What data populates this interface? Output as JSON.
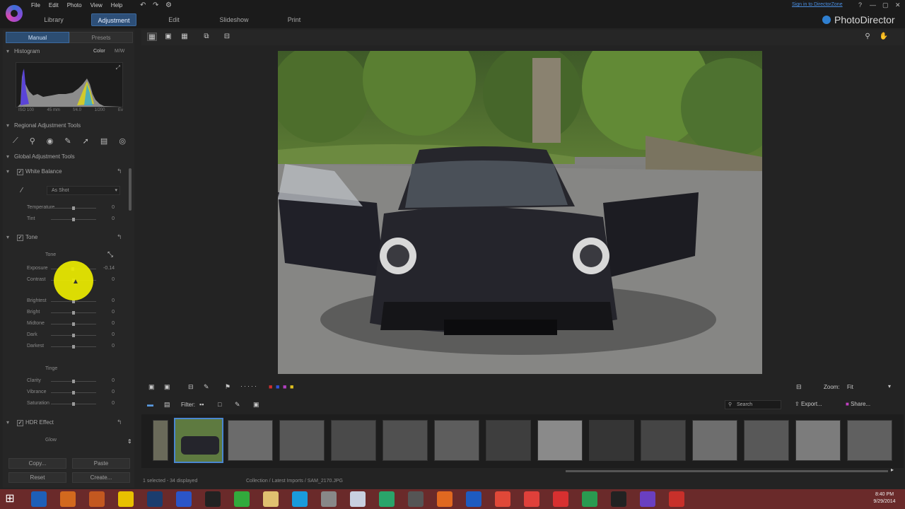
{
  "menu": [
    "File",
    "Edit",
    "Photo",
    "View",
    "Help"
  ],
  "maintabs": [
    "Library",
    "Adjustment",
    "Edit",
    "Slideshow",
    "Print"
  ],
  "active_maintab": "Adjustment",
  "signin": "Sign in to DirectorZone",
  "window_controls": [
    "?",
    "—",
    "▢",
    "✕"
  ],
  "brand": "PhotoDirector",
  "left": {
    "subtabs": [
      "Manual",
      "Presets"
    ],
    "histogram": {
      "title": "Histogram",
      "color": "Color",
      "mw": "M/W",
      "info": [
        "ISO 100",
        "45 mm",
        "f/4.0",
        "1/200",
        "Ev"
      ]
    },
    "regional": "Regional Adjustment Tools",
    "global": "Global Adjustment Tools",
    "white_balance": {
      "title": "White Balance",
      "preset": "As Shot",
      "rows": [
        {
          "label": "Temperature",
          "value": "0",
          "pos": 0.5
        },
        {
          "label": "Tint",
          "value": "0",
          "pos": 0.5
        }
      ]
    },
    "tone": {
      "title": "Tone",
      "sub": "Tone",
      "rows": [
        {
          "label": "Exposure",
          "value": "-0.14",
          "pos": 0.48
        },
        {
          "label": "Contrast",
          "value": "0",
          "pos": 0.5
        }
      ],
      "rows2": [
        {
          "label": "Brightest",
          "value": "0"
        },
        {
          "label": "Bright",
          "value": "0"
        },
        {
          "label": "Midtone",
          "value": "0"
        },
        {
          "label": "Dark",
          "value": "0"
        },
        {
          "label": "Darkest",
          "value": "0"
        }
      ],
      "tinge": "Tinge",
      "rows3": [
        {
          "label": "Clarity",
          "value": "0"
        },
        {
          "label": "Vibrance",
          "value": "0"
        },
        {
          "label": "Saturation",
          "value": "0"
        }
      ]
    },
    "hdr": {
      "title": "HDR Effect",
      "sub": "Glow"
    },
    "buttons": {
      "copy": "Copy...",
      "paste": "Paste",
      "reset": "Reset",
      "create": "Create..."
    }
  },
  "filters": {
    "label": "Filter:",
    "zoom_label": "Zoom:",
    "zoom_value": "Fit",
    "search_placeholder": "Search",
    "export": "Export...",
    "share": "Share..."
  },
  "status": {
    "count": "1 selected - 34 displayed",
    "path": "Collection / Latest Imports / SAM_2170.JPG"
  },
  "clock": {
    "time": "8:40 PM",
    "date": "9/29/2014"
  },
  "taskbar_colors": [
    "#1e5fb8",
    "#d2691e",
    "#c35820",
    "#e8c000",
    "#1b3d6e",
    "#2b55c8",
    "#222",
    "#32aa3c",
    "#e0c070",
    "#1a9bdc",
    "#888",
    "#c8d0e0",
    "#2aa56a",
    "#555",
    "#e06820",
    "#1e5bc0",
    "#e04838",
    "#e0403a",
    "#d83030",
    "#2a9a50",
    "#222",
    "#6a3fc0",
    "#c8302a"
  ]
}
